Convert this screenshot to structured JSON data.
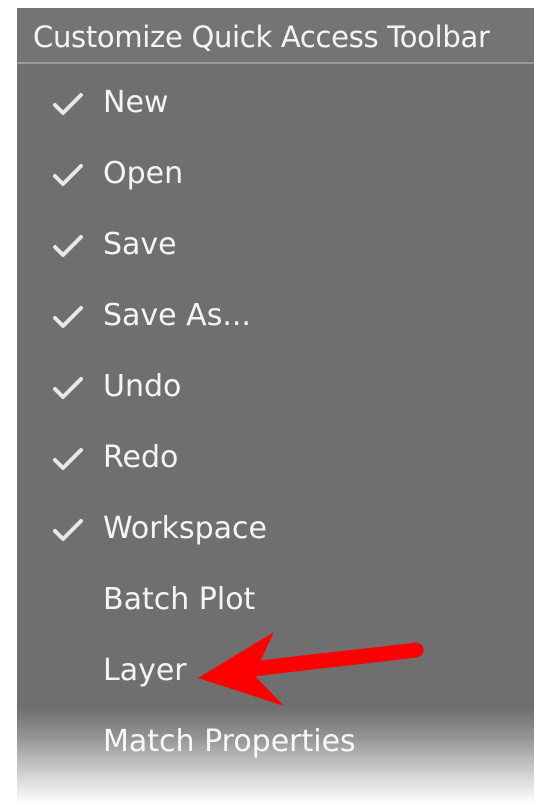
{
  "menu": {
    "title": "Customize Quick Access Toolbar",
    "items": [
      {
        "label": "New",
        "checked": true
      },
      {
        "label": "Open",
        "checked": true
      },
      {
        "label": "Save",
        "checked": true
      },
      {
        "label": "Save As...",
        "checked": true
      },
      {
        "label": "Undo",
        "checked": true
      },
      {
        "label": "Redo",
        "checked": true
      },
      {
        "label": "Workspace",
        "checked": true
      },
      {
        "label": "Batch Plot",
        "checked": false
      },
      {
        "label": "Layer",
        "checked": false
      },
      {
        "label": "Match Properties",
        "checked": false
      }
    ]
  },
  "colors": {
    "menu_background": "#6f6f6f",
    "text": "#f4f4f4",
    "checkmark": "#e8e8e8",
    "annotation_arrow": "#ff0000"
  },
  "icons": {
    "check": "checkmark-icon",
    "annotation": "red-arrow-icon"
  }
}
